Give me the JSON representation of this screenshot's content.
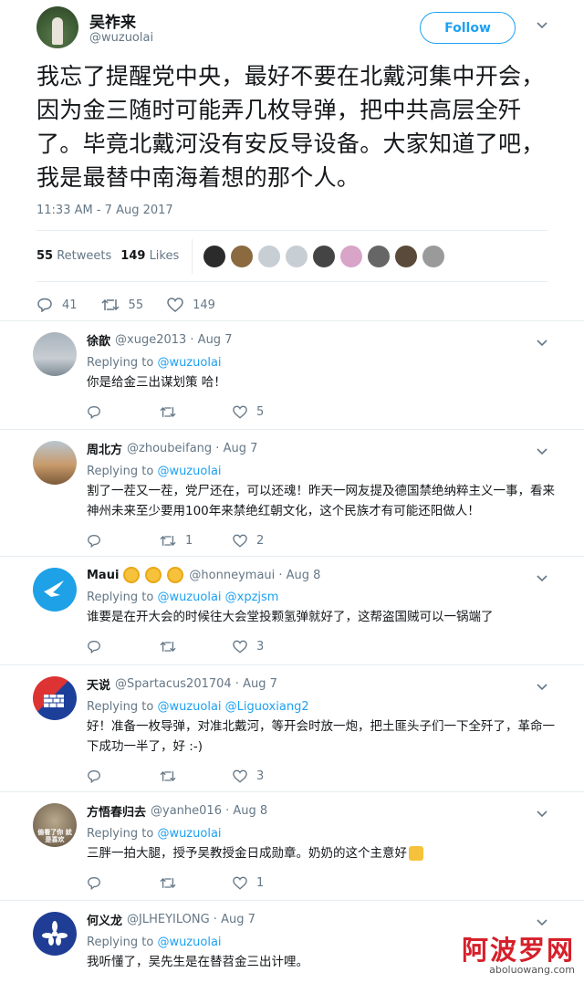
{
  "author": {
    "name": "吴祚来",
    "handle": "@wuzuolai",
    "follow_label": "Follow"
  },
  "tweet": {
    "text": "我忘了提醒党中央，最好不要在北戴河集中开会，因为金三随时可能弄几枚导弹，把中共高层全歼了。毕竟北戴河没有安反导设备。大家知道了吧，我是最替中南海着想的那个人。",
    "timestamp": "11:33 AM - 7 Aug 2017",
    "retweets_count": "55",
    "retweets_label": "Retweets",
    "likes_count": "149",
    "likes_label": "Likes",
    "reply_count": "41",
    "retweet_action_count": "55",
    "like_action_count": "149"
  },
  "replies": [
    {
      "name": "徐歆",
      "meta": "@xuge2013 · Aug 7",
      "replying_label": "Replying to",
      "replying_to": "@wuzuolai",
      "replying_to2": "",
      "text": "你是给金三出谋划策 哈！",
      "replies": "",
      "retweets": "",
      "likes": "5"
    },
    {
      "name": "周北方",
      "meta": "@zhoubeifang · Aug 7",
      "replying_label": "Replying to",
      "replying_to": "@wuzuolai",
      "replying_to2": "",
      "text": "割了一茬又一茬，党尸还在，可以还魂！昨天一网友提及德国禁绝纳粹主义一事，看来神州未来至少要用100年来禁绝红朝文化，这个民族才有可能还阳做人！",
      "replies": "",
      "retweets": "1",
      "likes": "2"
    },
    {
      "name": "Maui",
      "meta": "@honneymaui · Aug 8",
      "replying_label": "Replying to",
      "replying_to": "@wuzuolai",
      "replying_to2": "@xpzjsm",
      "text": "谁要是在开大会的时候往大会堂投颗氢弹就好了，这帮盗国贼可以一锅端了",
      "replies": "",
      "retweets": "",
      "likes": "3"
    },
    {
      "name": "天说",
      "meta": "@Spartacus201704 · Aug 7",
      "replying_label": "Replying to",
      "replying_to": "@wuzuolai",
      "replying_to2": "@Liguoxiang2",
      "text": "好！准备一枚导弹，对准北戴河，等开会时放一炮，把土匪头子们一下全歼了，革命一下成功一半了，好 :-)",
      "replies": "",
      "retweets": "",
      "likes": "3"
    },
    {
      "name": "方悟春归去",
      "meta": "@yanhe016 · Aug 8",
      "replying_label": "Replying to",
      "replying_to": "@wuzuolai",
      "replying_to2": "",
      "text": "三胖一拍大腿，授予吴教授金日成勋章。奶奶的这个主意好",
      "replies": "",
      "retweets": "",
      "likes": "1"
    },
    {
      "name": "何义龙",
      "meta": "@JLHEYILONG · Aug 7",
      "replying_label": "Replying to",
      "replying_to": "@wuzuolai",
      "replying_to2": "",
      "text": "我听懂了，吴先生是在替苕金三出计哩。",
      "replies": "",
      "retweets": "",
      "likes": ""
    }
  ],
  "avatar_labels": {
    "reply5": "偷看了你 就是喜欢"
  },
  "watermark": {
    "cn": "阿波罗网",
    "url": "aboluowang.com"
  },
  "colors": {
    "accent": "#1da1f2",
    "text": "#14171a",
    "muted": "#657786",
    "border": "#e6ecf0",
    "watermark": "#d6202a"
  }
}
